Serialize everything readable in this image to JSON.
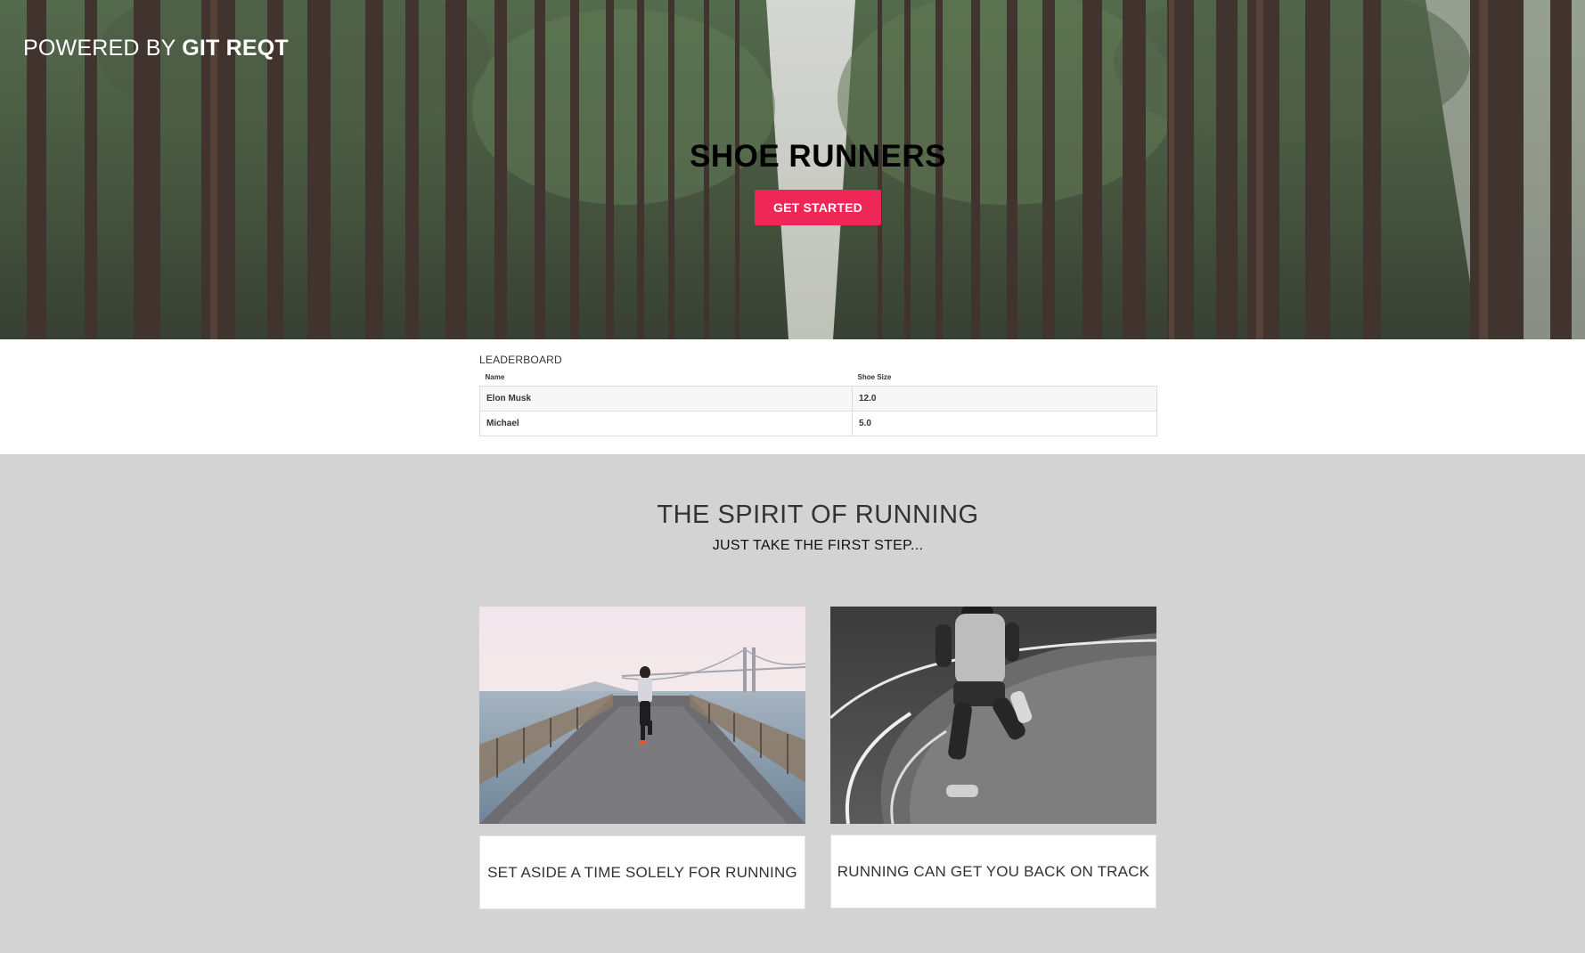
{
  "brand": {
    "prefix": "POWERED BY",
    "name": "GIT REQT"
  },
  "hero": {
    "title": "SHOE RUNNERS",
    "cta_label": "GET STARTED"
  },
  "leaderboard": {
    "title": "LEADERBOARD",
    "columns": [
      "Name",
      "Shoe Size"
    ],
    "rows": [
      {
        "name": "Elon Musk",
        "shoe_size": "12.0"
      },
      {
        "name": "Michael",
        "shoe_size": "5.0"
      }
    ]
  },
  "spirit": {
    "title": "THE SPIRIT OF RUNNING",
    "subtitle": "JUST TAKE THE FIRST STEP...",
    "cards": [
      {
        "caption": "SET ASIDE A TIME SOLELY FOR RUNNING"
      },
      {
        "caption": "RUNNING CAN GET YOU BACK ON TRACK"
      }
    ]
  },
  "colors": {
    "accent": "#ee2756",
    "band_background": "#d3d3d3",
    "table_border": "#dcdcdc"
  }
}
